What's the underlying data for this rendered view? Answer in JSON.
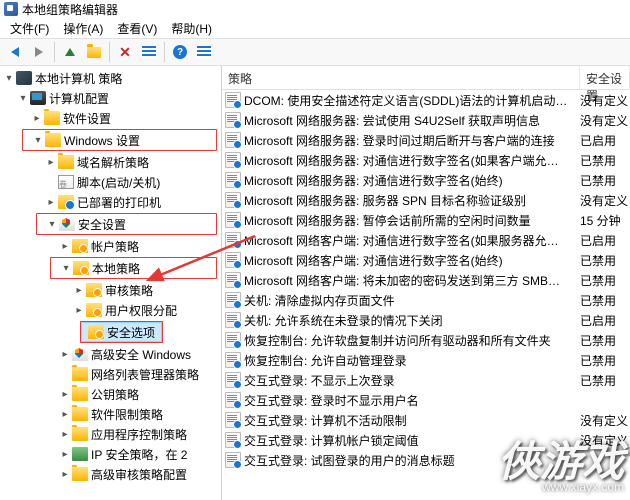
{
  "window": {
    "title": "本地组策略编辑器"
  },
  "menu": {
    "file": "文件(F)",
    "action": "操作(A)",
    "view": "查看(V)",
    "help": "帮助(H)"
  },
  "tree": {
    "root": "本地计算机 策略",
    "computer_config": "计算机配置",
    "software_settings": "软件设置",
    "windows_settings": "Windows 设置",
    "name_resolution": "域名解析策略",
    "scripts": "脚本(启动/关机)",
    "deployed_printers": "已部署的打印机",
    "security_settings": "安全设置",
    "account_policy": "帐户策略",
    "local_policy": "本地策略",
    "audit_policy": "审核策略",
    "user_rights": "用户权限分配",
    "security_options": "安全选项",
    "advanced_windows": "高级安全 Windows",
    "network_list": "网络列表管理器策略",
    "public_key": "公钥策略",
    "software_restrict": "软件限制策略",
    "app_control": "应用程序控制策略",
    "ip_security": "IP 安全策略，在 2",
    "advanced_audit": "高级审核策略配置"
  },
  "columns": {
    "policy": "策略",
    "setting": "安全设置"
  },
  "rows": [
    {
      "p": "DCOM: 使用安全描述符定义语言(SDDL)语法的计算机启动…",
      "s": "没有定义"
    },
    {
      "p": "Microsoft 网络服务器: 尝试使用 S4U2Self 获取声明信息",
      "s": "没有定义"
    },
    {
      "p": "Microsoft 网络服务器: 登录时间过期后断开与客户端的连接",
      "s": "已启用"
    },
    {
      "p": "Microsoft 网络服务器: 对通信进行数字签名(如果客户端允…",
      "s": "已禁用"
    },
    {
      "p": "Microsoft 网络服务器: 对通信进行数字签名(始终)",
      "s": "已禁用"
    },
    {
      "p": "Microsoft 网络服务器: 服务器 SPN 目标名称验证级别",
      "s": "没有定义"
    },
    {
      "p": "Microsoft 网络服务器: 暂停会话前所需的空闲时间数量",
      "s": "15 分钟"
    },
    {
      "p": "Microsoft 网络客户端: 对通信进行数字签名(如果服务器允…",
      "s": "已启用"
    },
    {
      "p": "Microsoft 网络客户端: 对通信进行数字签名(始终)",
      "s": "已禁用"
    },
    {
      "p": "Microsoft 网络客户端: 将未加密的密码发送到第三方 SMB…",
      "s": "已禁用"
    },
    {
      "p": "关机: 清除虚拟内存页面文件",
      "s": "已禁用"
    },
    {
      "p": "关机: 允许系统在未登录的情况下关闭",
      "s": "已启用"
    },
    {
      "p": "恢复控制台: 允许软盘复制并访问所有驱动器和所有文件夹",
      "s": "已禁用"
    },
    {
      "p": "恢复控制台: 允许自动管理登录",
      "s": "已禁用"
    },
    {
      "p": "交互式登录: 不显示上次登录",
      "s": "已禁用"
    },
    {
      "p": "交互式登录: 登录时不显示用户名",
      "s": ""
    },
    {
      "p": "交互式登录: 计算机不活动限制",
      "s": "没有定义"
    },
    {
      "p": "交互式登录: 计算机帐户锁定阈值",
      "s": "没有定义"
    },
    {
      "p": "交互式登录: 试图登录的用户的消息标题",
      "s": ""
    }
  ],
  "watermark": {
    "brand": "俠游戏",
    "url": "www.xiayx.com"
  }
}
